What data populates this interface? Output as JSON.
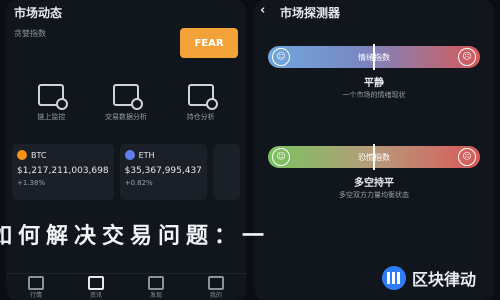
{
  "left": {
    "title": "市场动态",
    "subtitle": "贪婪指数",
    "fear_badge": "FEAR",
    "icons": [
      {
        "label": "链上监控",
        "icon": "chain-monitor-icon"
      },
      {
        "label": "交易数据分析",
        "icon": "trade-analysis-icon"
      },
      {
        "label": "持仓分析",
        "icon": "position-analysis-icon"
      }
    ],
    "cards": [
      {
        "coin": "BTC",
        "price": "$1,217,211,003,698",
        "change": "+1.38%"
      },
      {
        "coin": "ETH",
        "price": "$35,367,995,437",
        "change": "+0.82%"
      },
      {
        "coin": "",
        "price": "",
        "change": ""
      }
    ],
    "tabs": [
      "行情",
      "资讯",
      "发现",
      "我的"
    ]
  },
  "right": {
    "title": "市场探测器",
    "gauge1": {
      "label": "情绪指数",
      "caption": "平静",
      "desc": "一个市场的情绪现状",
      "level": 0.5
    },
    "gauge2": {
      "label": "恐慌指数",
      "caption": "多空持平",
      "desc": "多空双方力量均衡状态",
      "level": 0.5
    }
  },
  "overlay_text": "如何解决交易问题：一",
  "brand": {
    "name": "区块律动"
  },
  "colors": {
    "fear": "#f3a23a",
    "brand": "#2e7cf6"
  }
}
